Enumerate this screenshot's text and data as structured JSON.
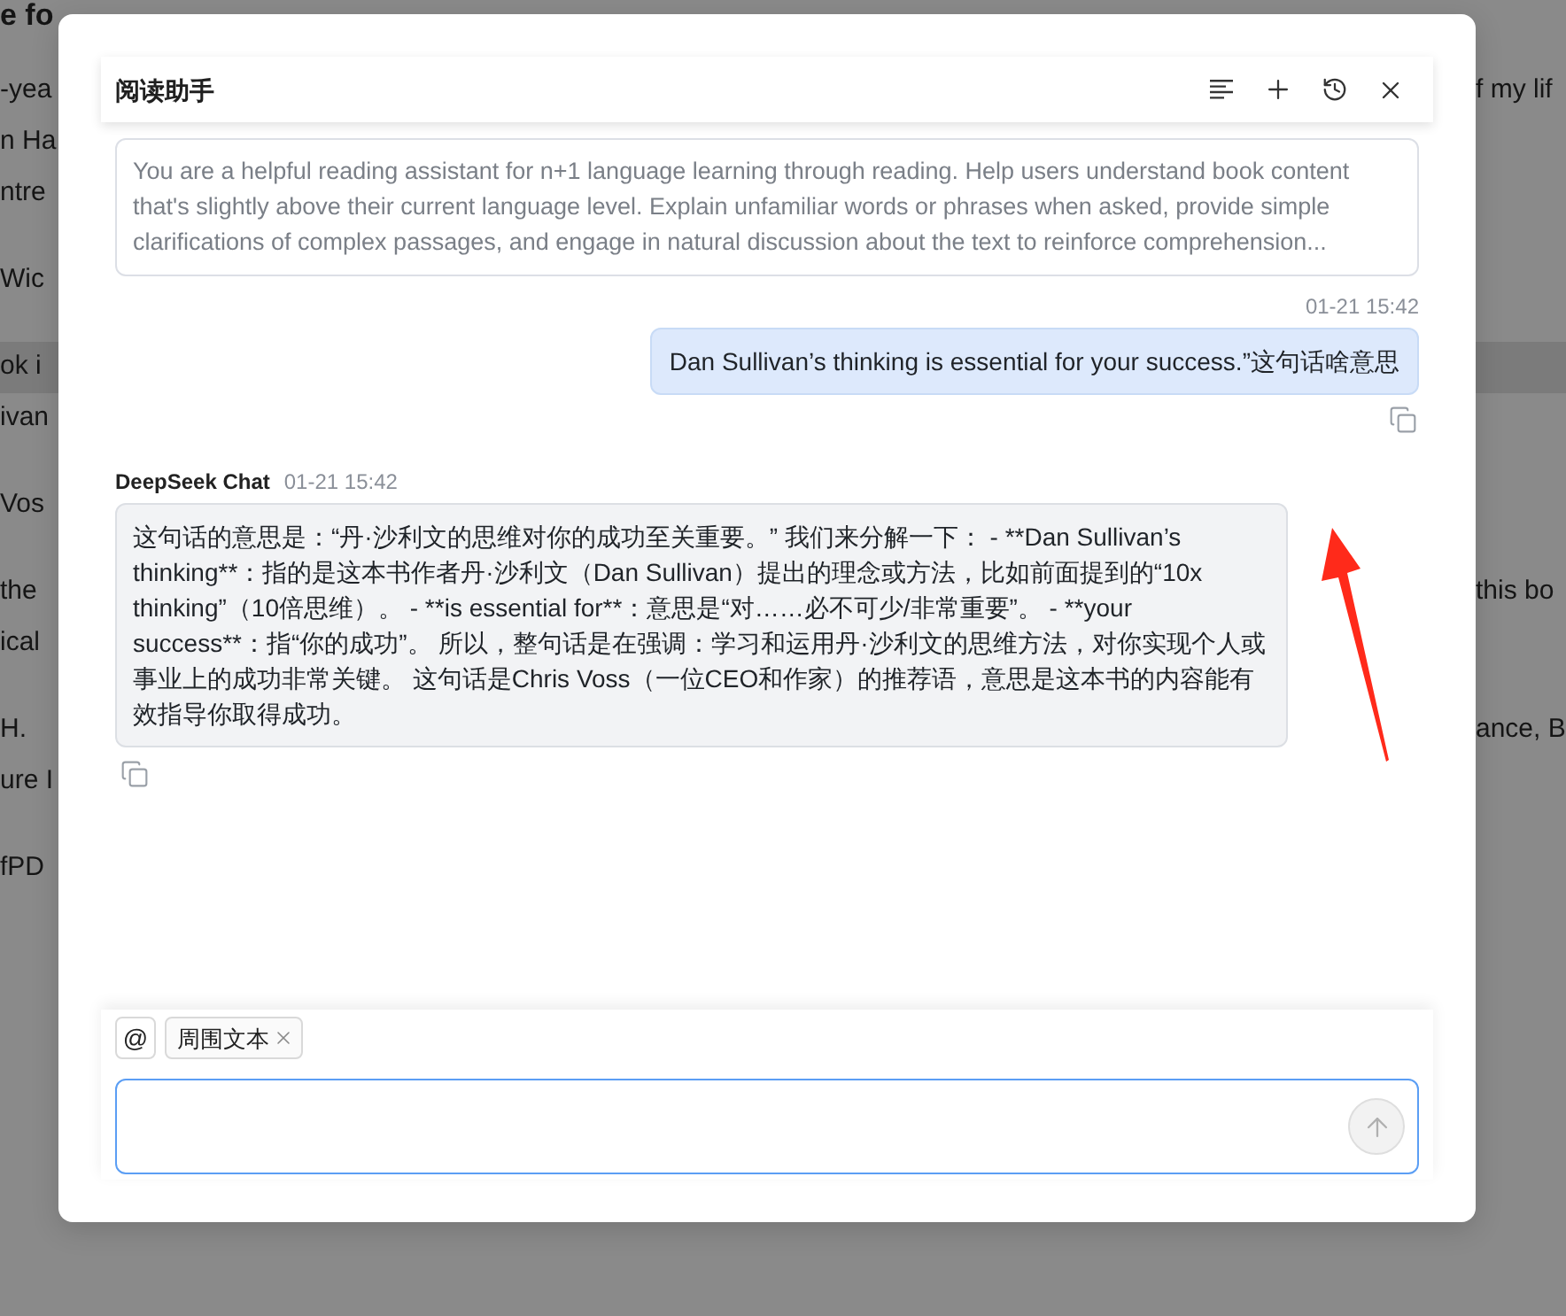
{
  "background_page": {
    "heading": "e fo",
    "paragraphs": [
      {
        "lines": [
          {
            "left": "-yea",
            "right": "f my lif",
            "highlighted": false
          },
          {
            "left": "n Ha",
            "highlighted": false
          },
          {
            "left": "ntre",
            "highlighted": false
          }
        ]
      },
      {
        "lines": [
          {
            "left": "Wic",
            "highlighted": false
          }
        ]
      },
      {
        "lines": [
          {
            "left": "ok i",
            "highlighted": true
          },
          {
            "left": "ivan",
            "highlighted": false
          }
        ]
      },
      {
        "lines": [
          {
            "left": "Vos",
            "highlighted": false
          }
        ]
      },
      {
        "lines": [
          {
            "left": "the",
            "right": "this bo",
            "highlighted": false
          },
          {
            "left": "ical",
            "highlighted": false
          }
        ]
      },
      {
        "lines": [
          {
            "left": "H.",
            "right": "ance, B",
            "highlighted": false
          },
          {
            "left": "ure I",
            "highlighted": false
          }
        ]
      },
      {
        "lines": [
          {
            "left": "fPD",
            "highlighted": false
          }
        ]
      }
    ]
  },
  "dialog": {
    "title": "阅读助手",
    "system_prompt": "You are a helpful reading assistant for n+1 language learning through reading. Help users understand book content that's slightly above their current language level. Explain unfamiliar words or phrases when asked, provide simple clarifications of complex passages, and engage in natural discussion about the text to reinforce comprehension...",
    "messages": [
      {
        "kind": "user",
        "time": "01-21 15:42",
        "text": "Dan Sullivan’s thinking is essential for your success.”这句话啥意思"
      },
      {
        "kind": "assistant",
        "sender": "DeepSeek Chat",
        "time": "01-21 15:42",
        "text": "这句话的意思是：“丹·沙利文的思维对你的成功至关重要。” 我们来分解一下： - **Dan Sullivan’s thinking**：指的是这本书作者丹·沙利文（Dan Sullivan）提出的理念或方法，比如前面提到的“10x thinking”（10倍思维）。 - **is essential for**：意思是“对……必不可少/非常重要”。 - **your success**：指“你的成功”。 所以，整句话是在强调：学习和运用丹·沙利文的思维方法，对你实现个人或事业上的成功非常关键。 这句话是Chris Voss（一位CEO和作家）的推荐语，意思是这本书的内容能有效指导你取得成功。"
      }
    ],
    "composer": {
      "mention": "@",
      "chips": [
        {
          "label": "周围文本"
        }
      ],
      "input": {
        "focused": true
      },
      "send_button": {
        "disabled": true
      }
    }
  }
}
